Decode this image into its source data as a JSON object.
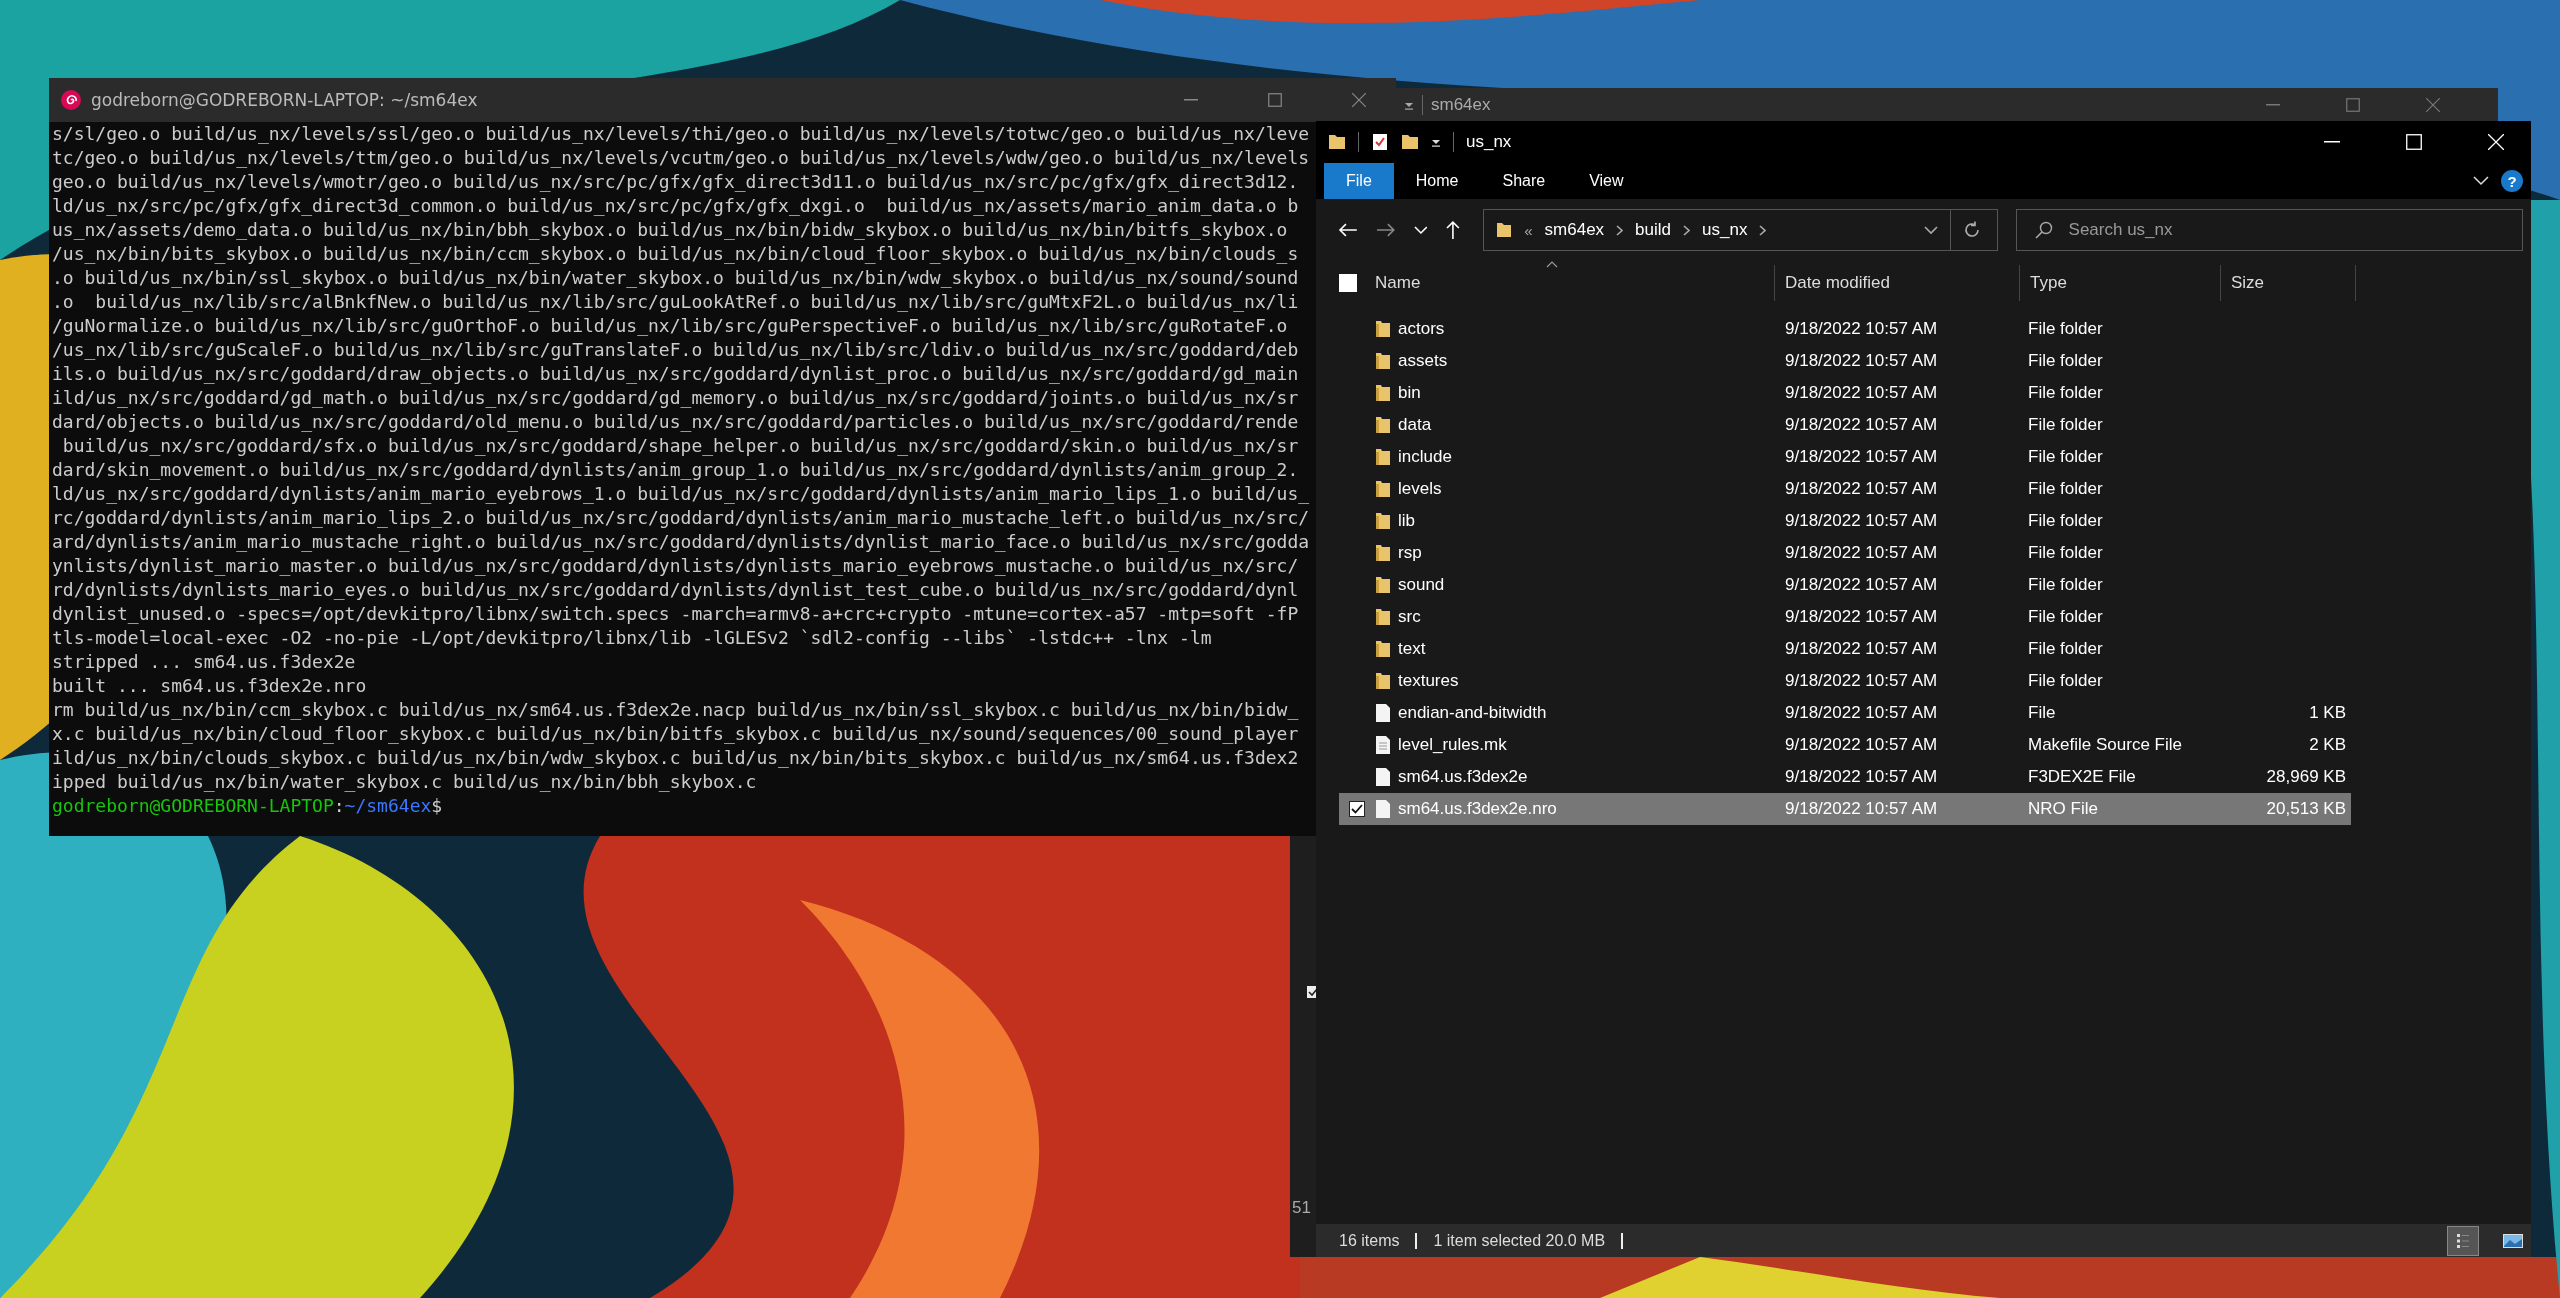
{
  "terminal": {
    "title": "godreborn@GODREBORN-LAPTOP: ~/sm64ex",
    "lines": [
      "s/sl/geo.o build/us_nx/levels/ssl/geo.o build/us_nx/levels/thi/geo.o build/us_nx/levels/totwc/geo.o build/us_nx/leve",
      "tc/geo.o build/us_nx/levels/ttm/geo.o build/us_nx/levels/vcutm/geo.o build/us_nx/levels/wdw/geo.o build/us_nx/levels",
      "geo.o build/us_nx/levels/wmotr/geo.o build/us_nx/src/pc/gfx/gfx_direct3d11.o build/us_nx/src/pc/gfx/gfx_direct3d12.",
      "ld/us_nx/src/pc/gfx/gfx_direct3d_common.o build/us_nx/src/pc/gfx/gfx_dxgi.o  build/us_nx/assets/mario_anim_data.o b",
      "us_nx/assets/demo_data.o build/us_nx/bin/bbh_skybox.o build/us_nx/bin/bidw_skybox.o build/us_nx/bin/bitfs_skybox.o",
      "/us_nx/bin/bits_skybox.o build/us_nx/bin/ccm_skybox.o build/us_nx/bin/cloud_floor_skybox.o build/us_nx/bin/clouds_s",
      ".o build/us_nx/bin/ssl_skybox.o build/us_nx/bin/water_skybox.o build/us_nx/bin/wdw_skybox.o build/us_nx/sound/sound",
      ".o  build/us_nx/lib/src/alBnkfNew.o build/us_nx/lib/src/guLookAtRef.o build/us_nx/lib/src/guMtxF2L.o build/us_nx/li",
      "/guNormalize.o build/us_nx/lib/src/guOrthoF.o build/us_nx/lib/src/guPerspectiveF.o build/us_nx/lib/src/guRotateF.o",
      "/us_nx/lib/src/guScaleF.o build/us_nx/lib/src/guTranslateF.o build/us_nx/lib/src/ldiv.o build/us_nx/src/goddard/deb",
      "ils.o build/us_nx/src/goddard/draw_objects.o build/us_nx/src/goddard/dynlist_proc.o build/us_nx/src/goddard/gd_main",
      "ild/us_nx/src/goddard/gd_math.o build/us_nx/src/goddard/gd_memory.o build/us_nx/src/goddard/joints.o build/us_nx/sr",
      "dard/objects.o build/us_nx/src/goddard/old_menu.o build/us_nx/src/goddard/particles.o build/us_nx/src/goddard/rende",
      " build/us_nx/src/goddard/sfx.o build/us_nx/src/goddard/shape_helper.o build/us_nx/src/goddard/skin.o build/us_nx/sr",
      "dard/skin_movement.o build/us_nx/src/goddard/dynlists/anim_group_1.o build/us_nx/src/goddard/dynlists/anim_group_2.",
      "ld/us_nx/src/goddard/dynlists/anim_mario_eyebrows_1.o build/us_nx/src/goddard/dynlists/anim_mario_lips_1.o build/us_",
      "rc/goddard/dynlists/anim_mario_lips_2.o build/us_nx/src/goddard/dynlists/anim_mario_mustache_left.o build/us_nx/src/",
      "ard/dynlists/anim_mario_mustache_right.o build/us_nx/src/goddard/dynlists/dynlist_mario_face.o build/us_nx/src/godda",
      "ynlists/dynlist_mario_master.o build/us_nx/src/goddard/dynlists/dynlists_mario_eyebrows_mustache.o build/us_nx/src/",
      "rd/dynlists/dynlists_mario_eyes.o build/us_nx/src/goddard/dynlists/dynlist_test_cube.o build/us_nx/src/goddard/dynl",
      "dynlist_unused.o -specs=/opt/devkitpro/libnx/switch.specs -march=armv8-a+crc+crypto -mtune=cortex-a57 -mtp=soft -fP",
      "tls-model=local-exec -O2 -no-pie -L/opt/devkitpro/libnx/lib -lGLESv2 `sdl2-config --libs` -lstdc++ -lnx -lm",
      "stripped ... sm64.us.f3dex2e",
      "built ... sm64.us.f3dex2e.nro",
      "rm build/us_nx/bin/ccm_skybox.c build/us_nx/sm64.us.f3dex2e.nacp build/us_nx/bin/ssl_skybox.c build/us_nx/bin/bidw_",
      "x.c build/us_nx/bin/cloud_floor_skybox.c build/us_nx/bin/bitfs_skybox.c build/us_nx/sound/sequences/00_sound_player",
      "ild/us_nx/bin/clouds_skybox.c build/us_nx/bin/wdw_skybox.c build/us_nx/bin/bits_skybox.c build/us_nx/sm64.us.f3dex2",
      "ipped build/us_nx/bin/water_skybox.c build/us_nx/bin/bbh_skybox.c"
    ],
    "prompt": {
      "user": "godreborn@GODREBORN-LAPTOP",
      "separator": ":",
      "path": "~/sm64ex",
      "symbol": "$"
    }
  },
  "partial_window": {
    "text": "51"
  },
  "explorer_behind": {
    "title": "sm64ex"
  },
  "explorer": {
    "title": "us_nx",
    "ribbon_tabs": [
      {
        "label": "File",
        "selected": true
      },
      {
        "label": "Home",
        "selected": false
      },
      {
        "label": "Share",
        "selected": false
      },
      {
        "label": "View",
        "selected": false
      }
    ],
    "help": "?",
    "address": {
      "overflow": "«",
      "path": [
        "sm64ex",
        "build",
        "us_nx"
      ]
    },
    "search": {
      "placeholder": "Search us_nx"
    },
    "select_all_checked": false,
    "columns": [
      "Name",
      "Date modified",
      "Type",
      "Size"
    ],
    "rows": [
      {
        "name": "actors",
        "date": "9/18/2022 10:57 AM",
        "type": "File folder",
        "kind": "folder",
        "selected": false
      },
      {
        "name": "assets",
        "date": "9/18/2022 10:57 AM",
        "type": "File folder",
        "kind": "folder",
        "selected": false
      },
      {
        "name": "bin",
        "date": "9/18/2022 10:57 AM",
        "type": "File folder",
        "kind": "folder",
        "selected": false
      },
      {
        "name": "data",
        "date": "9/18/2022 10:57 AM",
        "type": "File folder",
        "kind": "folder",
        "selected": false
      },
      {
        "name": "include",
        "date": "9/18/2022 10:57 AM",
        "type": "File folder",
        "kind": "folder",
        "selected": false
      },
      {
        "name": "levels",
        "date": "9/18/2022 10:57 AM",
        "type": "File folder",
        "kind": "folder",
        "selected": false
      },
      {
        "name": "lib",
        "date": "9/18/2022 10:57 AM",
        "type": "File folder",
        "kind": "folder",
        "selected": false
      },
      {
        "name": "rsp",
        "date": "9/18/2022 10:57 AM",
        "type": "File folder",
        "kind": "folder",
        "selected": false
      },
      {
        "name": "sound",
        "date": "9/18/2022 10:57 AM",
        "type": "File folder",
        "kind": "folder",
        "selected": false
      },
      {
        "name": "src",
        "date": "9/18/2022 10:57 AM",
        "type": "File folder",
        "kind": "folder",
        "selected": false
      },
      {
        "name": "text",
        "date": "9/18/2022 10:57 AM",
        "type": "File folder",
        "kind": "folder",
        "selected": false
      },
      {
        "name": "textures",
        "date": "9/18/2022 10:57 AM",
        "type": "File folder",
        "kind": "folder",
        "selected": false
      },
      {
        "name": "endian-and-bitwidth",
        "date": "9/18/2022 10:57 AM",
        "type": "File",
        "size": "1 KB",
        "kind": "file",
        "selected": false
      },
      {
        "name": "level_rules.mk",
        "date": "9/18/2022 10:57 AM",
        "type": "Makefile Source File",
        "size": "2 KB",
        "kind": "document",
        "selected": false
      },
      {
        "name": "sm64.us.f3dex2e",
        "date": "9/18/2022 10:57 AM",
        "type": "F3DEX2E File",
        "size": "28,969 KB",
        "kind": "file",
        "selected": false
      },
      {
        "name": "sm64.us.f3dex2e.nro",
        "date": "9/18/2022 10:57 AM",
        "type": "NRO File",
        "size": "20,513 KB",
        "kind": "file",
        "selected": true
      }
    ],
    "status": {
      "count": "16 items",
      "selection": "1 item selected  20.0 MB"
    },
    "view_modes": [
      {
        "kind": "details",
        "selected": true
      },
      {
        "kind": "large-icons",
        "selected": false
      }
    ]
  }
}
